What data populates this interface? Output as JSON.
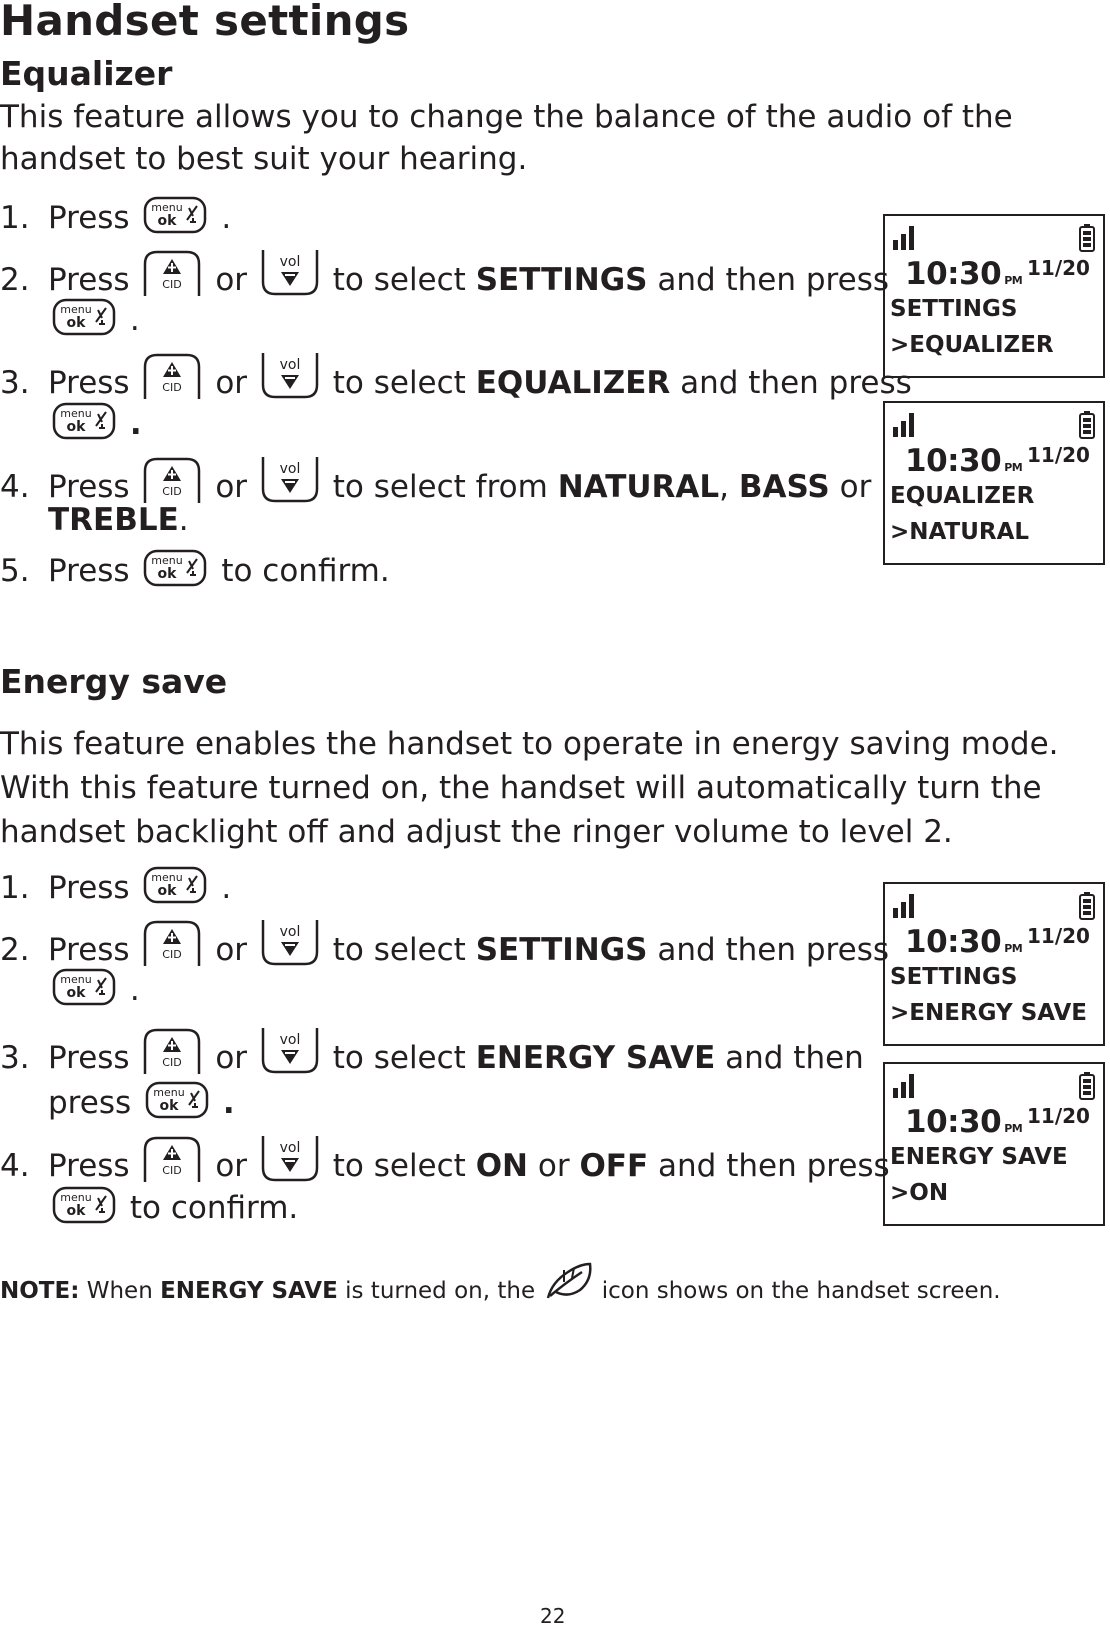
{
  "title": "Handset settings",
  "equalizer": {
    "heading": "Equalizer",
    "intro_line1": "This feature allows you to change the balance of the audio of the",
    "intro_line2": "handset to best suit your hearing.",
    "steps": [
      {
        "num": "1.",
        "pre": "Press",
        "post": "."
      },
      {
        "num": "2.",
        "pre": "Press",
        "or": "or",
        "mid": "to select",
        "bold": "SETTINGS",
        "post": "and then press"
      },
      {
        "num": "3.",
        "pre": "Press",
        "or": "or",
        "mid": "to select",
        "bold": "EQUALIZER",
        "post": "and then press"
      },
      {
        "num": "4.",
        "pre": "Press",
        "or": "or",
        "mid": "to select from",
        "bold1": "NATURAL",
        "sep": ",",
        "bold2": "BASS",
        "or2": "or",
        "bold3": "TREBLE",
        "end": "."
      },
      {
        "num": "5.",
        "pre": "Press",
        "post": "to confirm."
      }
    ],
    "screens": [
      {
        "time": "10:30",
        "ampm": "PM",
        "date": "11/20",
        "line1": "SETTINGS",
        "line2": ">EQUALIZER"
      },
      {
        "time": "10:30",
        "ampm": "PM",
        "date": "11/20",
        "line1": "EQUALIZER",
        "line2": ">NATURAL"
      }
    ]
  },
  "energy": {
    "heading": "Energy save",
    "intro_line1": "This feature enables the handset to operate in energy saving mode.",
    "intro_line2": "With this feature turned on, the handset will automatically turn the",
    "intro_line3": "handset backlight off and adjust the ringer volume to level 2.",
    "steps": [
      {
        "num": "1.",
        "pre": "Press",
        "post": "."
      },
      {
        "num": "2.",
        "pre": "Press",
        "or": "or",
        "mid": "to select",
        "bold": "SETTINGS",
        "post": "and then press"
      },
      {
        "num": "3.",
        "pre": "Press",
        "or": "or",
        "mid": "to select",
        "bold": "ENERGY SAVE",
        "post": "and then",
        "cont": "press"
      },
      {
        "num": "4.",
        "pre": "Press",
        "or": "or",
        "mid": "to select",
        "bold1": "ON",
        "or2": "or",
        "bold2": "OFF",
        "post": "and then press",
        "cont_post": "to confirm."
      }
    ],
    "screens": [
      {
        "time": "10:30",
        "ampm": "PM",
        "date": "11/20",
        "line1": "SETTINGS",
        "line2": ">ENERGY SAVE"
      },
      {
        "time": "10:30",
        "ampm": "PM",
        "date": "11/20",
        "line1": "ENERGY SAVE",
        "line2": ">ON"
      }
    ]
  },
  "keys": {
    "menu_top": "menu",
    "menu_bottom": "ok",
    "cid": "CID",
    "vol": "vol"
  },
  "note": {
    "label": "NOTE:",
    "pre": "When",
    "bold": "ENERGY SAVE",
    "mid": "is turned on, the",
    "post": "icon shows on the handset screen."
  },
  "page_number": "22"
}
